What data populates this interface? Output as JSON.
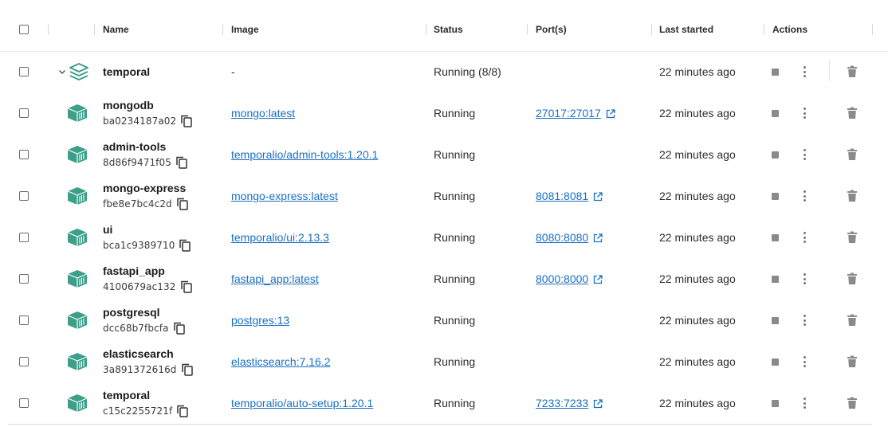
{
  "header": {
    "name": "Name",
    "image": "Image",
    "status": "Status",
    "ports": "Port(s)",
    "last_started": "Last started",
    "actions": "Actions"
  },
  "group": {
    "name": "temporal",
    "image": "-",
    "status": "Running (8/8)",
    "last_started": "22 minutes ago",
    "icon": "stack-icon"
  },
  "containers": [
    {
      "name": "mongodb",
      "id": "ba0234187a02",
      "image": "mongo:latest",
      "status": "Running",
      "ports": "27017:27017",
      "last_started": "22 minutes ago"
    },
    {
      "name": "admin-tools",
      "id": "8d86f9471f05",
      "image": "temporalio/admin-tools:1.20.1",
      "status": "Running",
      "ports": "",
      "last_started": "22 minutes ago"
    },
    {
      "name": "mongo-express",
      "id": "fbe8e7bc4c2d",
      "image": "mongo-express:latest",
      "status": "Running",
      "ports": "8081:8081",
      "last_started": "22 minutes ago"
    },
    {
      "name": "ui",
      "id": "bca1c9389710",
      "image": "temporalio/ui:2.13.3",
      "status": "Running",
      "ports": "8080:8080",
      "last_started": "22 minutes ago"
    },
    {
      "name": "fastapi_app",
      "id": "4100679ac132",
      "image": "fastapi_app:latest",
      "status": "Running",
      "ports": "8000:8000",
      "last_started": "22 minutes ago"
    },
    {
      "name": "postgresql",
      "id": "dcc68b7fbcfa",
      "image": "postgres:13",
      "status": "Running",
      "ports": "",
      "last_started": "22 minutes ago"
    },
    {
      "name": "elasticsearch",
      "id": "3a891372616d",
      "image": "elasticsearch:7.16.2",
      "status": "Running",
      "ports": "",
      "last_started": "22 minutes ago"
    },
    {
      "name": "temporal",
      "id": "c15c2255721f",
      "image": "temporalio/auto-setup:1.20.1",
      "status": "Running",
      "ports": "7233:7233",
      "last_started": "22 minutes ago"
    }
  ],
  "colors": {
    "container_icon": "#3d9f8a",
    "link": "#1a6fc3",
    "action_icon": "#8a8a8a"
  }
}
